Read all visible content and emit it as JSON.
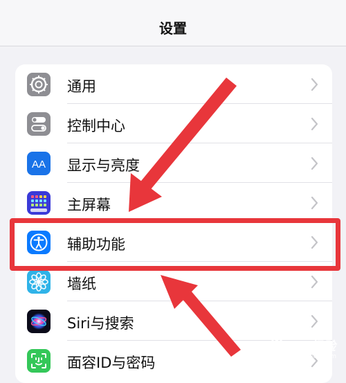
{
  "header": {
    "title": "设置"
  },
  "settings": {
    "items": [
      {
        "label": "通用",
        "icon": "gear-icon"
      },
      {
        "label": "控制中心",
        "icon": "toggles-icon"
      },
      {
        "label": "显示与亮度",
        "icon": "text-size-icon",
        "icon_text": "AA"
      },
      {
        "label": "主屏幕",
        "icon": "home-grid-icon"
      },
      {
        "label": "辅助功能",
        "icon": "accessibility-icon"
      },
      {
        "label": "墙纸",
        "icon": "flower-icon"
      },
      {
        "label": "Siri与搜索",
        "icon": "siri-icon"
      },
      {
        "label": "面容ID与密码",
        "icon": "face-id-icon"
      }
    ],
    "highlighted_index": 4
  },
  "colors": {
    "annotation_red": "#e8363b",
    "page_background": "#f2f2f6",
    "gear_gray": "#8e8e93",
    "display_blue": "#1a73e8",
    "accessibility_blue": "#0a7aff",
    "faceid_green": "#34c759"
  },
  "watermark": {
    "text": "Bai经验",
    "sub": "jingyan.baidu.com"
  }
}
